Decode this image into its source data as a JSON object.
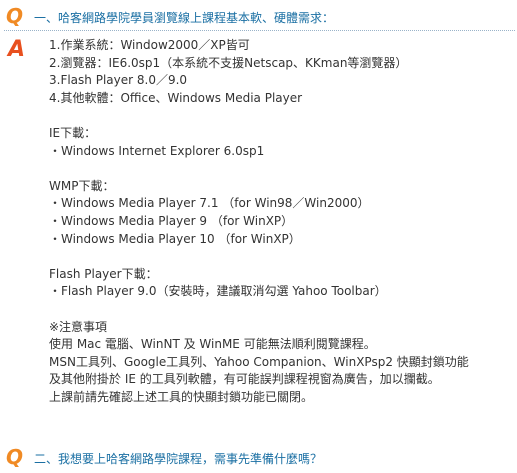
{
  "colors": {
    "question_text": "#1a6fa3",
    "q_icon": "#f08a24",
    "a_icon": "#e8501f",
    "body_text": "#333333"
  },
  "q1": {
    "icon": "Q",
    "title": "一、哈客網路學院學員瀏覽線上課程基本軟、硬體需求：",
    "answer_icon": "A",
    "lines": [
      "1.作業系統：Window2000／XP皆可",
      "2.瀏覽器：IE6.0sp1（本系統不支援Netscap、KKman等瀏覽器）",
      "3.Flash Player 8.0／9.0",
      "4.其他軟體：Office、Windows Media Player",
      "",
      "IE下載：",
      "・Windows Internet Explorer 6.0sp1",
      "",
      "WMP下載：",
      "・Windows Media Player 7.1 （for Win98／Win2000）",
      "・Windows Media Player 9 （for WinXP）",
      "・Windows Media Player 10 （for WinXP）",
      "",
      "Flash Player下載：",
      "・Flash Player 9.0（安裝時，建議取消勾選 Yahoo Toolbar）",
      "",
      "※注意事項",
      "使用 Mac 電腦、WinNT 及 WinME 可能無法順利閱覽課程。",
      "MSN工具列、Google工具列、Yahoo Companion、WinXPsp2 快顯封鎖功能",
      "及其他附掛於 IE 的工具列軟體，有可能誤判課程視窗為廣告，加以攔截。",
      "上課前請先確認上述工具的快顯封鎖功能已關閉。"
    ]
  },
  "q2": {
    "icon": "Q",
    "title": "二、我想要上哈客網路學院課程，需事先準備什麼嗎？"
  }
}
